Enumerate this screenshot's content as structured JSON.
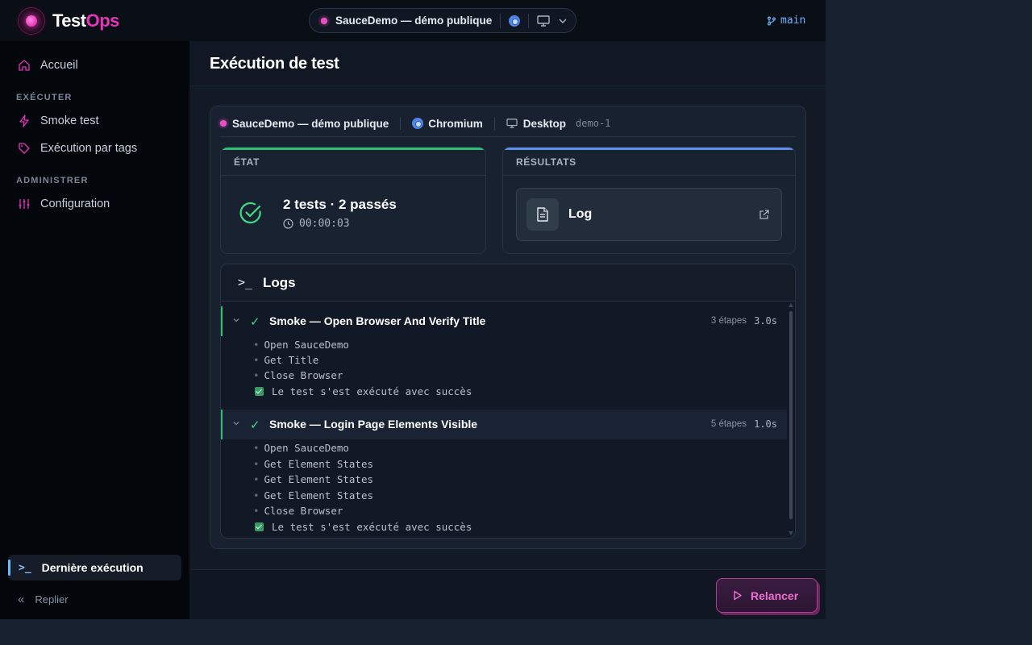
{
  "brand": {
    "name_a": "Test",
    "name_b": "Ops"
  },
  "header": {
    "project": "SauceDemo — démo publique",
    "branch": "main"
  },
  "sidebar": {
    "home": "Accueil",
    "section_execute": "EXÉCUTER",
    "smoke": "Smoke test",
    "by_tags": "Exécution par tags",
    "section_admin": "ADMINISTRER",
    "config": "Configuration",
    "last_run": "Dernière exécution",
    "collapse": "Replier"
  },
  "page": {
    "title": "Exécution de test",
    "context": {
      "project": "SauceDemo — démo publique",
      "browser": "Chromium",
      "device": "Desktop",
      "env": "demo-1"
    },
    "state": {
      "title": "ÉTAT",
      "summary": "2 tests · 2 passés",
      "duration": "00:00:03"
    },
    "results": {
      "title": "RÉSULTATS",
      "log_label": "Log"
    },
    "logs": {
      "title": "Logs",
      "tests": [
        {
          "name": "Smoke — Open Browser And Verify Title",
          "steps_label": "3 étapes",
          "time": "3.0s",
          "steps": [
            "Open SauceDemo",
            "Get Title",
            "Close Browser"
          ],
          "result": "Le test s'est exécuté avec succès"
        },
        {
          "name": "Smoke — Login Page Elements Visible",
          "steps_label": "5 étapes",
          "time": "1.0s",
          "steps": [
            "Open SauceDemo",
            "Get Element States",
            "Get Element States",
            "Get Element States",
            "Close Browser"
          ],
          "result": "Le test s'est exécuté avec succès"
        }
      ]
    },
    "relaunch": "Relancer"
  },
  "colors": {
    "accent_pink": "#e535b8",
    "success_green": "#2fbf71",
    "info_blue": "#6cb6ff"
  }
}
